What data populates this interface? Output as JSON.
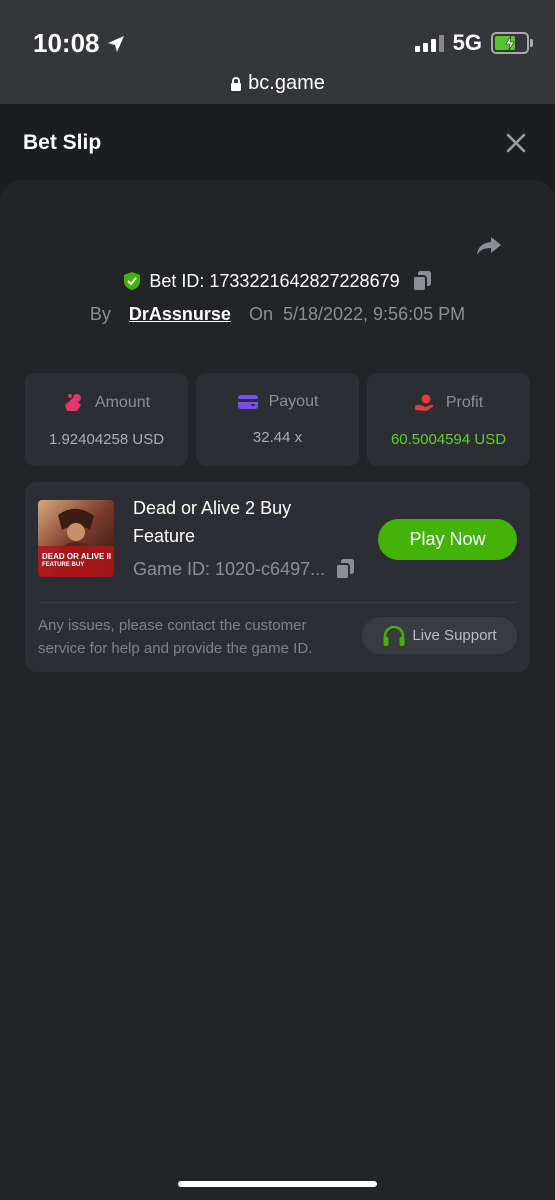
{
  "status_bar": {
    "time": "10:08",
    "network": "5G",
    "url": "bc.game"
  },
  "header": {
    "title": "Bet Slip"
  },
  "bet": {
    "id_label": "Bet ID: 1733221642827228679",
    "by_label": "By",
    "username": "DrAssnurse",
    "on_label": "On",
    "datetime": "5/18/2022, 9:56:05 PM"
  },
  "stats": {
    "amount": {
      "label": "Amount",
      "value": "1.92404258 USD",
      "icon": "amount-icon"
    },
    "payout": {
      "label": "Payout",
      "value": "32.44 x",
      "icon": "wallet-icon"
    },
    "profit": {
      "label": "Profit",
      "value": "60.5004594 USD",
      "icon": "profit-icon"
    }
  },
  "game": {
    "title": "Dead or Alive 2 Buy Feature",
    "game_id": "Game ID: 1020-c6497...",
    "play_label": "Play Now",
    "thumb_title": "DEAD OR ALIVE II",
    "thumb_subtitle": "FEATURE BUY"
  },
  "support": {
    "message": "Any issues, please contact the customer service for help and provide the game ID.",
    "button_label": "Live Support"
  },
  "colors": {
    "accent_green": "#43b309",
    "profit_green": "#5fcf2b",
    "background": "#1c1d21",
    "card": "#2d2e33"
  }
}
